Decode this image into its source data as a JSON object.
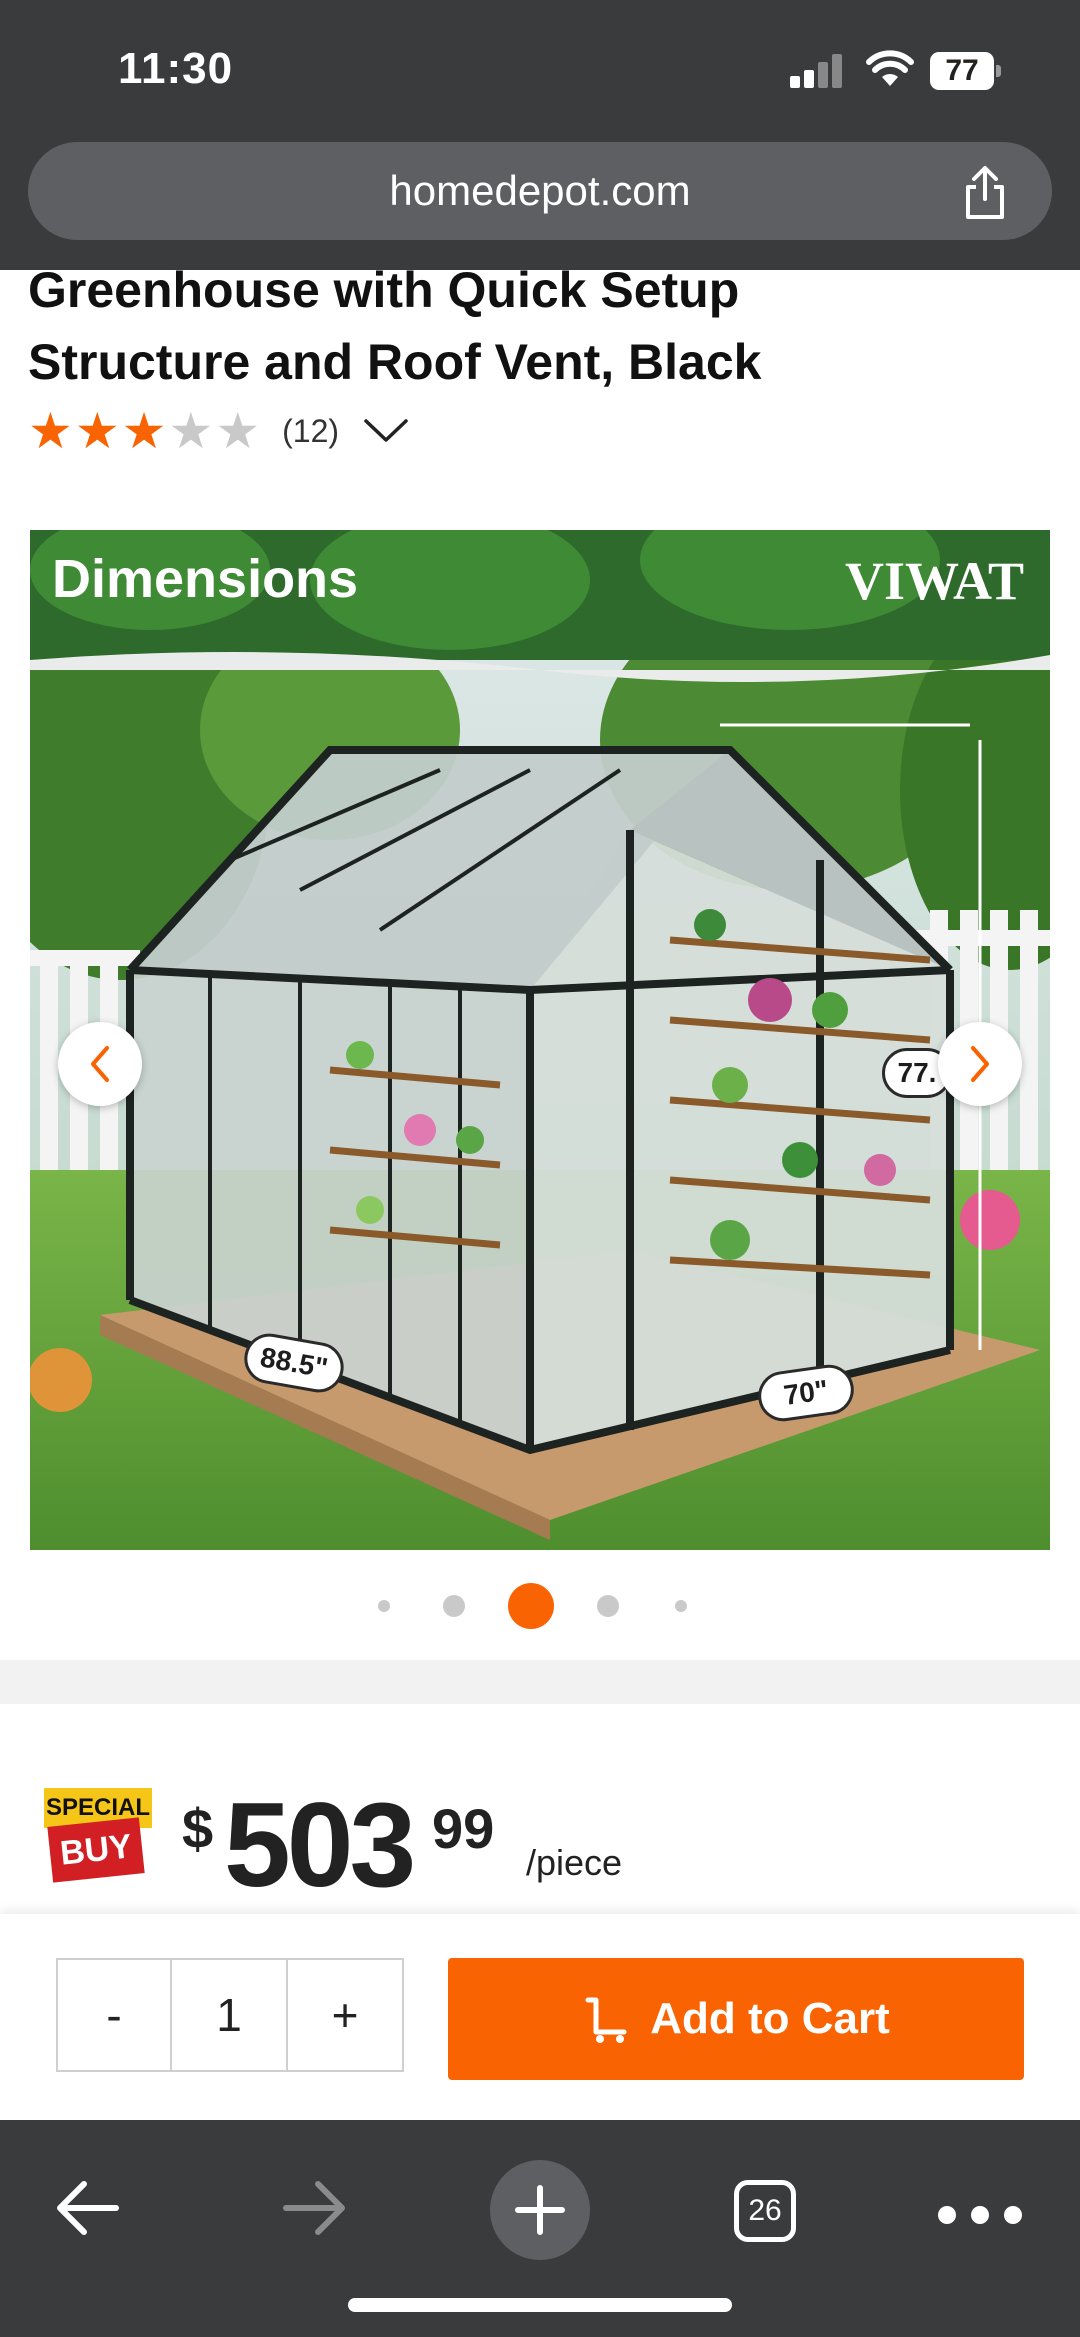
{
  "status_bar": {
    "time": "11:30",
    "battery": "77"
  },
  "browser": {
    "url": "homedepot.com",
    "tab_count": "26"
  },
  "product": {
    "title_line1": "Greenhouse with Quick Setup",
    "title_line2": "Structure and Roof Vent, Black",
    "rating": 3,
    "rating_max": 5,
    "review_count": "(12)",
    "image": {
      "heading": "Dimensions",
      "brand": "VIWAT",
      "dim_length": "88.5\"",
      "dim_width": "70\"",
      "dim_height": "77."
    },
    "carousel": {
      "total": 5,
      "active_index": 2
    }
  },
  "price": {
    "badge_top": "SPECIAL",
    "badge_bottom": "BUY",
    "currency": "$",
    "dollars": "503",
    "cents": "99",
    "unit": "/piece"
  },
  "cart": {
    "minus": "-",
    "quantity": "1",
    "plus": "+",
    "add_label": "Add to Cart"
  },
  "colors": {
    "accent": "#f96302",
    "chrome": "#3a3b3d",
    "badge_yellow": "#f5c518",
    "badge_red": "#d21f24"
  },
  "icons": {
    "share": "share-icon",
    "back": "back-arrow-icon",
    "forward": "forward-arrow-icon",
    "new_tab": "plus-icon",
    "tabs": "tabs-icon",
    "more": "more-icon"
  }
}
